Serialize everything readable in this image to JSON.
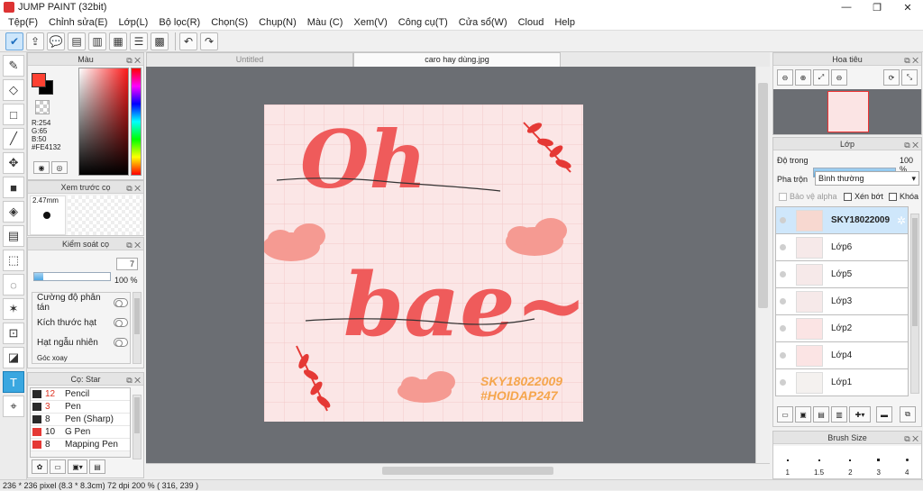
{
  "app": {
    "title": "JUMP PAINT (32bit)"
  },
  "window_buttons": {
    "minimize": "—",
    "maximize": "❐",
    "close": "✕"
  },
  "menu": [
    "Tệp(F)",
    "Chỉnh sửa(E)",
    "Lớp(L)",
    "Bộ lọc(R)",
    "Chọn(S)",
    "Chụp(N)",
    "Màu (C)",
    "Xem(V)",
    "Công cụ(T)",
    "Cửa sổ(W)",
    "Cloud",
    "Help"
  ],
  "panels": {
    "color": {
      "title": "Màu",
      "r": "R:254",
      "g": "G:65",
      "b": "B:50",
      "hex": "#FE4132",
      "main_color": "#fe4132"
    },
    "brush_preview": {
      "title": "Xem trước cọ",
      "size": "2.47mm"
    },
    "brush_control": {
      "title": "Kiểm soát cọ",
      "size_value": "7",
      "opacity_value": "100 %",
      "opacity_level": 1.0,
      "options": [
        "Cường độ phân tán",
        "Kích thước hạt",
        "Hạt ngẫu nhiên",
        "Góc xoay"
      ]
    },
    "brushes": {
      "title": "Cọ: Star",
      "items": [
        {
          "size": "12",
          "name": "Pencil",
          "color": "#2a2a2a",
          "size_red": true
        },
        {
          "size": "3",
          "name": "Pen",
          "color": "#2a2a2a",
          "size_red": true
        },
        {
          "size": "8",
          "name": "Pen (Sharp)",
          "color": "#2a2a2a",
          "size_red": false
        },
        {
          "size": "10",
          "name": "G Pen",
          "color": "#e53935",
          "size_red": false
        },
        {
          "size": "8",
          "name": "Mapping Pen",
          "color": "#e53935",
          "size_red": false
        }
      ]
    },
    "navigator": {
      "title": "Hoa tiêu"
    },
    "layers": {
      "title": "Lớp",
      "opacity_label": "Độ trong",
      "opacity_value": "100 %",
      "opacity_level": 1.0,
      "blend_label": "Pha trộn",
      "blend_value": "Bình thường",
      "protect_alpha": "Bảo vệ alpha",
      "clip": "Xén bớt",
      "lock": "Khóa",
      "items": [
        "SKY18022009",
        "Lớp6",
        "Lớp5",
        "Lớp3",
        "Lớp2",
        "Lớp4",
        "Lớp1"
      ]
    },
    "brush_size": {
      "title": "Brush Size",
      "sizes": [
        "1",
        "1.5",
        "2",
        "3",
        "4"
      ]
    }
  },
  "tabs": [
    {
      "label": "Untitled",
      "selected": false
    },
    {
      "label": "caro hay dùng.jpg",
      "selected": true
    }
  ],
  "artwork": {
    "line1": "Oh",
    "line2": "bae~",
    "signature1": "SKY18022009",
    "signature2": "#HOIDAP247",
    "accent": "#ef5b5b",
    "bg": "#fbe4e4"
  },
  "statusbar": {
    "text": "236 * 236 pixel  (8.3 * 8.3cm)  72 dpi  200 %  ( 316, 239 )"
  }
}
